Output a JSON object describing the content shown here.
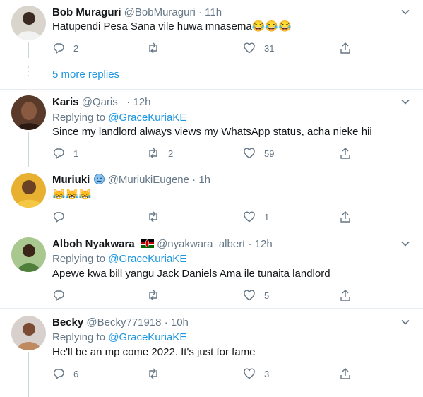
{
  "tweets": [
    {
      "name": "Bob Muraguri",
      "handle": "@BobMuraguri",
      "time": "11h",
      "text": "Hatupendi Pesa Sana vile huwa mnasema😂😂😂",
      "replies": "2",
      "retweets": "",
      "likes": "31"
    },
    {
      "name": "Karis",
      "handle": "@Qaris_",
      "time": "12h",
      "replying_prefix": "Replying to",
      "replying_to": "@GraceKuriaKE",
      "text": "Since my landlord always views my WhatsApp status, acha nieke hii",
      "replies": "1",
      "retweets": "2",
      "likes": "59"
    },
    {
      "name": "Muriuki",
      "handle": "@MuriukiEugene",
      "time": "1h",
      "text": "😹😹😹",
      "replies": "",
      "retweets": "",
      "likes": "1"
    },
    {
      "name": "Alboh Nyakwara",
      "handle": "@nyakwara_albert",
      "time": "12h",
      "replying_prefix": "Replying to",
      "replying_to": "@GraceKuriaKE",
      "text": "Apewe kwa bill yangu Jack Daniels Ama ile tunaita landlord",
      "replies": "",
      "retweets": "",
      "likes": "5"
    },
    {
      "name": "Becky",
      "handle": "@Becky771918",
      "time": "10h",
      "replying_prefix": "Replying to",
      "replying_to": "@GraceKuriaKE",
      "text": "He'll be an mp come 2022. It's just for fame",
      "replies": "6",
      "retweets": "",
      "likes": "3"
    }
  ],
  "more_replies": "5 more replies",
  "separator": "·",
  "colors": {
    "accent": "#1b95e0",
    "muted": "#657786",
    "divider": "#e6ecf0"
  },
  "icons": [
    "reply-icon",
    "retweet-icon",
    "like-icon",
    "share-icon",
    "chevron-down-icon",
    "emoji-badge-icon",
    "kenya-flag-icon"
  ]
}
